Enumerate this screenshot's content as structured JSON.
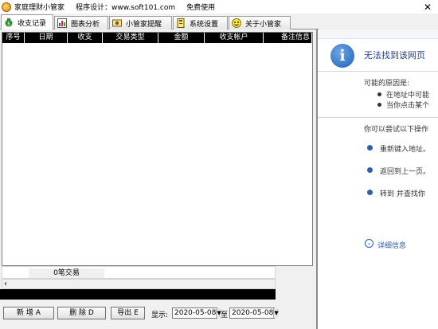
{
  "window": {
    "title": "家庭理财小管家",
    "designer": "程序设计：www.soft101.com",
    "free": "免费使用",
    "close": "✕"
  },
  "tabs": [
    {
      "label": "收支记录",
      "icon": "money-bag-icon"
    },
    {
      "label": "图表分析",
      "icon": "chart-icon"
    },
    {
      "label": "小管家提醒",
      "icon": "reminder-icon"
    },
    {
      "label": "系统设置",
      "icon": "settings-icon"
    },
    {
      "label": "关于小管家",
      "icon": "smiley-icon"
    }
  ],
  "table": {
    "columns": [
      "序号",
      "日期",
      "收支",
      "交易类型",
      "金额",
      "收支帐户",
      "备注信息"
    ],
    "rows": []
  },
  "status": {
    "count": "0笔交易"
  },
  "toolbar": {
    "add": "新 增  A",
    "delete": "删 除  D",
    "export": "导出 E",
    "display_label": "显示:",
    "date_from": "2020-05-08",
    "to_label": "至",
    "date_to": "2020-05-08"
  },
  "webpane": {
    "title": "无法找到该网页",
    "reasons_heading": "可能的原因是:",
    "reason1": "在地址中可能",
    "reason2": "当你点击某个",
    "try_heading": "你可以尝试以下操作",
    "action1": "重新键入地址。",
    "action2": "返回到上一页。",
    "action3": "转到  并查找你",
    "details": "详细信息"
  }
}
